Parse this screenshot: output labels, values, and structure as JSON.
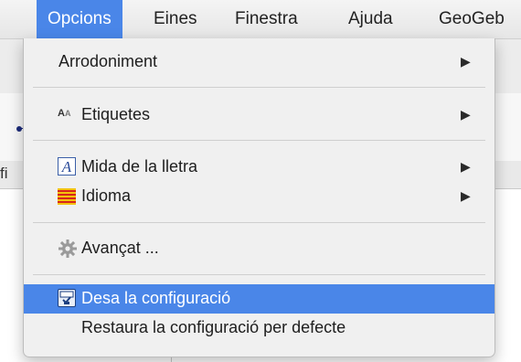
{
  "menubar": {
    "items": [
      {
        "label": "Opcions"
      },
      {
        "label": "Eines"
      },
      {
        "label": "Finestra"
      },
      {
        "label": "Ajuda"
      },
      {
        "label": "GeoGeb"
      }
    ]
  },
  "background": {
    "fragment_text": "fi"
  },
  "menu": {
    "items": [
      {
        "label": "Arrodoniment",
        "icon": "none",
        "submenu": true
      },
      {
        "label": "Etiquetes",
        "icon": "font-labels-icon",
        "submenu": true
      },
      {
        "label": "Mida de la lletra",
        "icon": "font-size-icon",
        "submenu": true
      },
      {
        "label": "Idioma",
        "icon": "flag-icon",
        "submenu": true
      },
      {
        "label": "Avançat ...",
        "icon": "gear-icon",
        "submenu": false
      },
      {
        "label": "Desa la configuració",
        "icon": "save-icon",
        "submenu": false,
        "highlighted": true
      },
      {
        "label": "Restaura la configuració per defecte",
        "icon": "none",
        "submenu": false
      }
    ],
    "submenu_arrow": "▶"
  },
  "colors": {
    "highlight": "#4a86e8",
    "menu_bg": "#f0f0f0"
  }
}
